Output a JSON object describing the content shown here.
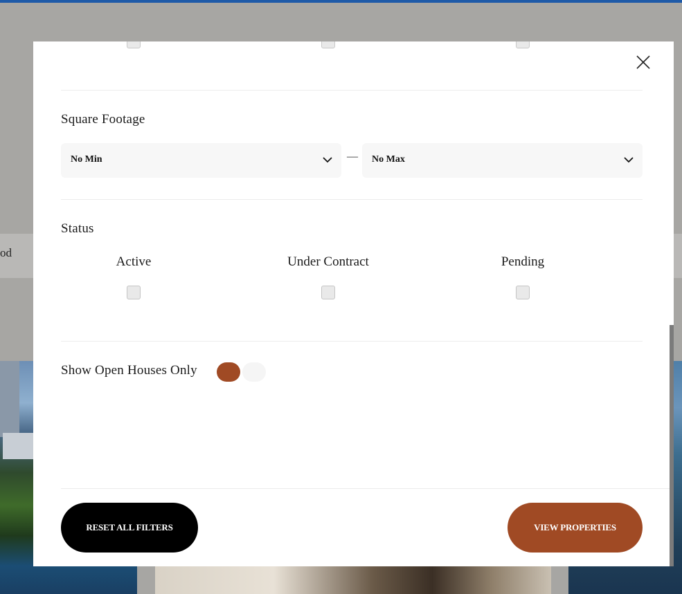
{
  "background": {
    "search_fragment": "od"
  },
  "modal": {
    "close_label": "×",
    "square_footage": {
      "title": "Square Footage",
      "min": {
        "value": "No Min"
      },
      "separator": "—",
      "max": {
        "value": "No Max"
      }
    },
    "status": {
      "title": "Status",
      "options": [
        {
          "label": "Active",
          "checked": false
        },
        {
          "label": "Under Contract",
          "checked": false
        },
        {
          "label": "Pending",
          "checked": false
        }
      ]
    },
    "open_houses": {
      "label": "Show Open Houses Only",
      "enabled": true
    },
    "footer": {
      "reset_label": "RESET ALL FILTERS",
      "view_label": "VIEW PROPERTIES"
    }
  },
  "colors": {
    "accent": "#a04a24",
    "overlay": "#a7a6a3",
    "top_bar": "#1e5aa8",
    "reset_button": "#000000"
  }
}
